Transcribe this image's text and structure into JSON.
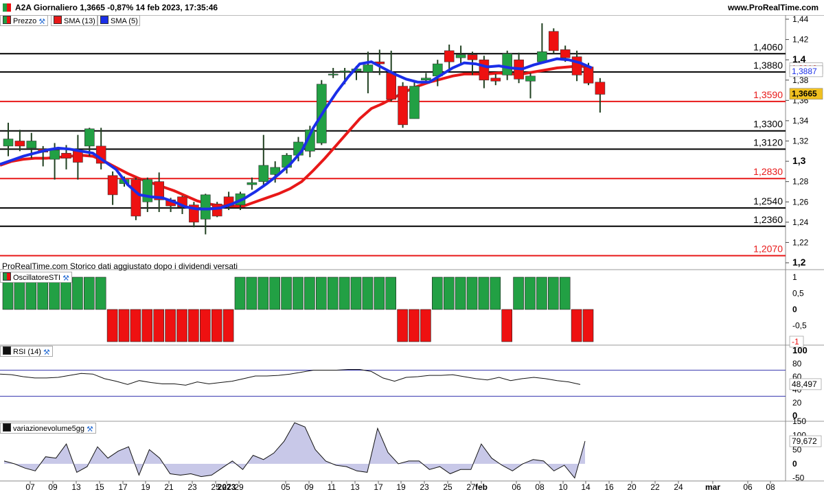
{
  "header": {
    "title": "A2A Giornaliero 1,3665 -0,87% 14 feb 2023, 17:35:46",
    "site": "www.ProRealTime.com"
  },
  "footer_note": "ProRealTime.com Storico dati aggiustato dopo i dividendi versati",
  "legends": {
    "prezzo": "Prezzo",
    "sma13": "SMA (13)",
    "sma5": "SMA (5)",
    "osc": "OscillatoreSTI",
    "rsi": "RSI (14)",
    "vol": "variazionevolume5gg"
  },
  "colors": {
    "up": "#22a044",
    "down": "#ee1111",
    "sma13": "#e81818",
    "sma5": "#1a2ee8",
    "level_black": "#000000",
    "level_red": "#e81818",
    "rsi_band": "#3a3ab0",
    "vol_fill": "#c8c8e8"
  },
  "chart_data": [
    {
      "type": "candlestick",
      "name": "price",
      "ylim": [
        1.19,
        1.45
      ],
      "yticks": [
        "1,44",
        "1,42",
        "1,4",
        "1,38",
        "1,36",
        "1,34",
        "1,32",
        "1,3",
        "1,28",
        "1,26",
        "1,24",
        "1,22",
        "1,2"
      ],
      "x_labels": [
        "07",
        "09",
        "13",
        "15",
        "17",
        "19",
        "21",
        "23",
        "25",
        "27",
        "29",
        "2023",
        "05",
        "09",
        "11",
        "13",
        "17",
        "19",
        "23",
        "25",
        "27",
        "feb",
        "06",
        "08",
        "10",
        "14",
        "16",
        "20",
        "22",
        "24",
        "mar",
        "06",
        "08"
      ],
      "candles": [
        [
          1.315,
          1.338,
          1.305,
          1.322
        ],
        [
          1.32,
          1.331,
          1.31,
          1.315
        ],
        [
          1.313,
          1.328,
          1.303,
          1.32
        ],
        [
          1.312,
          1.315,
          1.295,
          1.309
        ],
        [
          1.302,
          1.318,
          1.282,
          1.311
        ],
        [
          1.308,
          1.316,
          1.292,
          1.303
        ],
        [
          1.31,
          1.326,
          1.282,
          1.299
        ],
        [
          1.315,
          1.333,
          1.305,
          1.332
        ],
        [
          1.315,
          1.333,
          1.292,
          1.298
        ],
        [
          1.286,
          1.29,
          1.257,
          1.267
        ],
        [
          1.278,
          1.285,
          1.275,
          1.282
        ],
        [
          1.282,
          1.284,
          1.242,
          1.246
        ],
        [
          1.26,
          1.284,
          1.25,
          1.282
        ],
        [
          1.28,
          1.289,
          1.25,
          1.262
        ],
        [
          1.262,
          1.264,
          1.25,
          1.256
        ],
        [
          1.265,
          1.266,
          1.248,
          1.255
        ],
        [
          1.257,
          1.26,
          1.235,
          1.24
        ],
        [
          1.243,
          1.268,
          1.228,
          1.267
        ],
        [
          1.258,
          1.26,
          1.245,
          1.246
        ],
        [
          1.265,
          1.27,
          1.252,
          1.256
        ],
        [
          1.257,
          1.27,
          1.252,
          1.268
        ],
        [
          1.277,
          1.284,
          1.272,
          1.279
        ],
        [
          1.28,
          1.326,
          1.276,
          1.296
        ],
        [
          1.287,
          1.3,
          1.279,
          1.294
        ],
        [
          1.294,
          1.308,
          1.288,
          1.306
        ],
        [
          1.306,
          1.324,
          1.3,
          1.319
        ],
        [
          1.31,
          1.335,
          1.304,
          1.331
        ],
        [
          1.318,
          1.38,
          1.316,
          1.376
        ],
        [
          1.385,
          1.392,
          1.382,
          1.386
        ],
        [
          1.388,
          1.392,
          1.376,
          1.389
        ],
        [
          1.389,
          1.394,
          1.38,
          1.391
        ],
        [
          1.388,
          1.408,
          1.367,
          1.395
        ],
        [
          1.398,
          1.41,
          1.385,
          1.396
        ],
        [
          1.387,
          1.409,
          1.359,
          1.361
        ],
        [
          1.374,
          1.378,
          1.333,
          1.336
        ],
        [
          1.342,
          1.378,
          1.342,
          1.374
        ],
        [
          1.38,
          1.387,
          1.378,
          1.382
        ],
        [
          1.384,
          1.4,
          1.374,
          1.396
        ],
        [
          1.409,
          1.415,
          1.391,
          1.398
        ],
        [
          1.402,
          1.414,
          1.396,
          1.405
        ],
        [
          1.405,
          1.408,
          1.385,
          1.4
        ],
        [
          1.4,
          1.404,
          1.372,
          1.38
        ],
        [
          1.382,
          1.386,
          1.375,
          1.379
        ],
        [
          1.385,
          1.409,
          1.38,
          1.406
        ],
        [
          1.4,
          1.407,
          1.377,
          1.381
        ],
        [
          1.379,
          1.387,
          1.362,
          1.384
        ],
        [
          1.398,
          1.436,
          1.398,
          1.408
        ],
        [
          1.428,
          1.431,
          1.406,
          1.409
        ],
        [
          1.41,
          1.414,
          1.398,
          1.402
        ],
        [
          1.403,
          1.409,
          1.379,
          1.385
        ],
        [
          1.393,
          1.397,
          1.375,
          1.377
        ],
        [
          1.378,
          1.382,
          1.348,
          1.366
        ]
      ],
      "sma13": [
        1.296,
        1.3,
        1.302,
        1.303,
        1.303,
        1.304,
        1.305,
        1.306,
        1.305,
        1.3,
        1.294,
        1.288,
        1.283,
        1.279,
        1.275,
        1.271,
        1.266,
        1.261,
        1.258,
        1.256,
        1.256,
        1.256,
        1.26,
        1.264,
        1.268,
        1.273,
        1.28,
        1.291,
        1.303,
        1.316,
        1.329,
        1.342,
        1.352,
        1.357,
        1.363,
        1.369,
        1.374,
        1.378,
        1.381,
        1.384,
        1.386,
        1.386,
        1.386,
        1.387,
        1.386,
        1.386,
        1.388,
        1.39,
        1.392,
        1.393,
        1.394,
        1.392
      ],
      "sma5": [
        1.297,
        1.301,
        1.305,
        1.308,
        1.311,
        1.313,
        1.312,
        1.31,
        1.308,
        1.3,
        1.292,
        1.277,
        1.267,
        1.265,
        1.264,
        1.26,
        1.255,
        1.253,
        1.253,
        1.254,
        1.258,
        1.263,
        1.27,
        1.278,
        1.287,
        1.297,
        1.31,
        1.333,
        1.351,
        1.368,
        1.383,
        1.396,
        1.398,
        1.392,
        1.386,
        1.381,
        1.378,
        1.378,
        1.385,
        1.392,
        1.397,
        1.396,
        1.393,
        1.394,
        1.392,
        1.391,
        1.395,
        1.398,
        1.401,
        1.4,
        1.397,
        1.392
      ],
      "levels": [
        {
          "label": "1,4060",
          "value": 1.406,
          "color": "black"
        },
        {
          "label": "1,3880",
          "value": 1.388,
          "color": "black"
        },
        {
          "label": "1,3590",
          "value": 1.359,
          "color": "red"
        },
        {
          "label": "1,3300",
          "value": 1.33,
          "color": "black"
        },
        {
          "label": "1,3120",
          "value": 1.312,
          "color": "black"
        },
        {
          "label": "1,2830",
          "value": 1.283,
          "color": "red"
        },
        {
          "label": "1,2540",
          "value": 1.254,
          "color": "black"
        },
        {
          "label": "1,2360",
          "value": 1.236,
          "color": "black"
        },
        {
          "label": "1,2070",
          "value": 1.207,
          "color": "red"
        }
      ],
      "price_badges": {
        "last": "1,3665",
        "sma13": "1,3916",
        "sma5": "1,3887"
      }
    },
    {
      "type": "bar",
      "name": "OscillatoreSTI",
      "ylim": [
        -1,
        1
      ],
      "yticks": [
        "1",
        "0,5",
        "0",
        "-0,5"
      ],
      "last_label": "-1",
      "values": [
        1,
        1,
        1,
        1,
        1,
        1,
        1,
        1,
        1,
        -1,
        -1,
        -1,
        -1,
        -1,
        -1,
        -1,
        -1,
        -1,
        -1,
        -1,
        1,
        1,
        1,
        1,
        1,
        1,
        1,
        1,
        1,
        1,
        1,
        1,
        1,
        1,
        -1,
        -1,
        -1,
        1,
        1,
        1,
        1,
        1,
        1,
        -1,
        1,
        1,
        1,
        1,
        1,
        -1,
        -1
      ]
    },
    {
      "type": "line",
      "name": "RSI (14)",
      "ylim": [
        0,
        100
      ],
      "yticks": [
        "100",
        "80",
        "60",
        "40",
        "20",
        "0"
      ],
      "bands": [
        70,
        30
      ],
      "last_label": "48,497",
      "values": [
        64,
        63,
        60,
        58,
        58,
        59,
        62,
        65,
        64,
        57,
        53,
        48,
        54,
        51,
        49,
        49,
        47,
        52,
        49,
        51,
        53,
        57,
        61,
        61,
        62,
        64,
        67,
        70,
        70,
        70,
        71,
        71,
        68,
        58,
        53,
        59,
        60,
        62,
        62,
        63,
        60,
        57,
        55,
        59,
        54,
        57,
        59,
        57,
        54,
        52,
        48
      ]
    },
    {
      "type": "area",
      "name": "variazionevolume5gg",
      "ylim": [
        -70,
        160
      ],
      "yticks": [
        "150",
        "100",
        "50",
        "0",
        "-50"
      ],
      "last_label": "79,672",
      "values": [
        10,
        0,
        -15,
        -25,
        25,
        20,
        70,
        -30,
        -10,
        60,
        20,
        45,
        60,
        -40,
        50,
        20,
        -35,
        -40,
        -35,
        -45,
        -40,
        -15,
        10,
        -20,
        30,
        15,
        38,
        80,
        145,
        130,
        50,
        10,
        -5,
        -10,
        -25,
        -30,
        125,
        40,
        0,
        10,
        10,
        -20,
        -10,
        -35,
        -20,
        -20,
        70,
        20,
        -5,
        -25,
        0,
        15,
        10,
        -25,
        -5,
        -50,
        80
      ]
    }
  ]
}
